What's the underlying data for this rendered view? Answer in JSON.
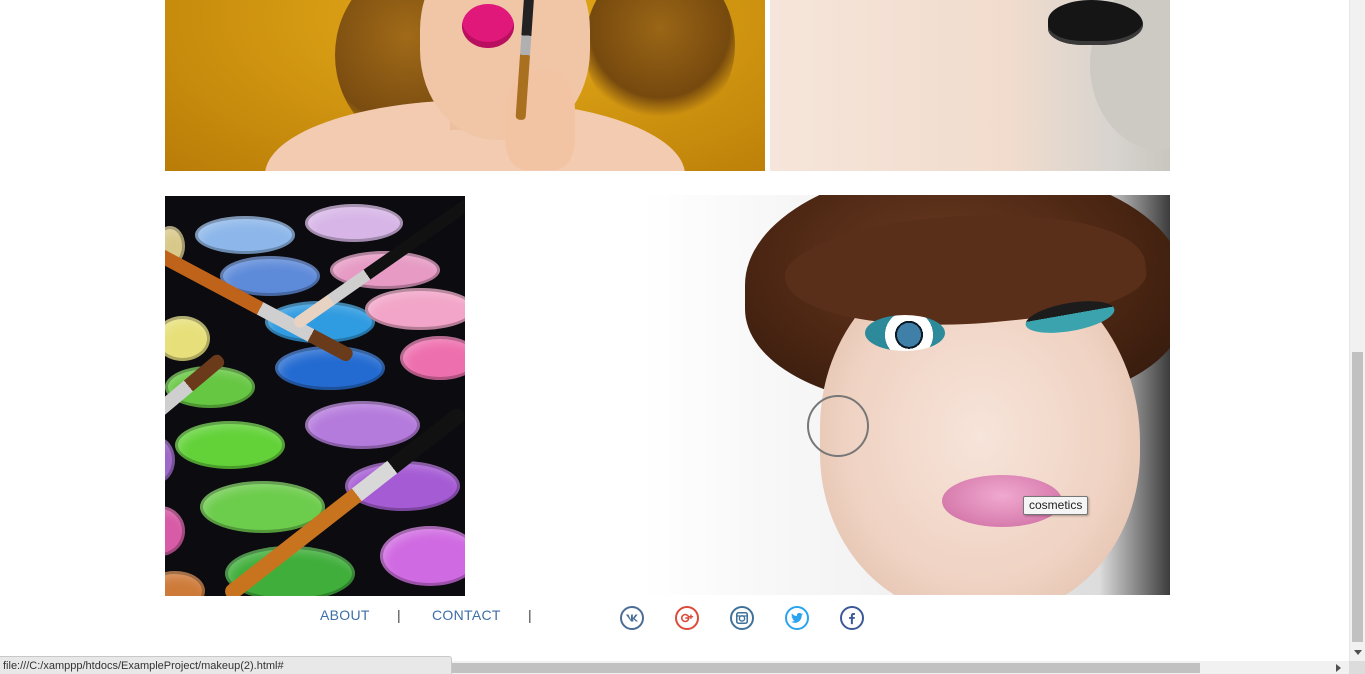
{
  "tooltip": {
    "text": "cosmetics"
  },
  "footer": {
    "nav": [
      {
        "label": "ABOUT"
      },
      {
        "label": "CONTACT"
      }
    ],
    "separator": "|",
    "social": [
      {
        "icon": "vk-icon",
        "glyph": "vk",
        "color": "#4a6d95"
      },
      {
        "icon": "google-plus-icon",
        "glyph": "g+",
        "color": "#dc4a38"
      },
      {
        "icon": "instagram-icon",
        "glyph": "ig",
        "color": "#3f729b"
      },
      {
        "icon": "twitter-icon",
        "glyph": "tw",
        "color": "#2aa3ef"
      },
      {
        "icon": "facebook-icon",
        "glyph": "f",
        "color": "#3b5998"
      }
    ]
  },
  "statusbar": {
    "url": "file:///C:/xamppp/htdocs/ExampleProject/makeup(2).html#"
  },
  "colors": {
    "link": "#3e6fa6",
    "background": "#ffffff"
  }
}
